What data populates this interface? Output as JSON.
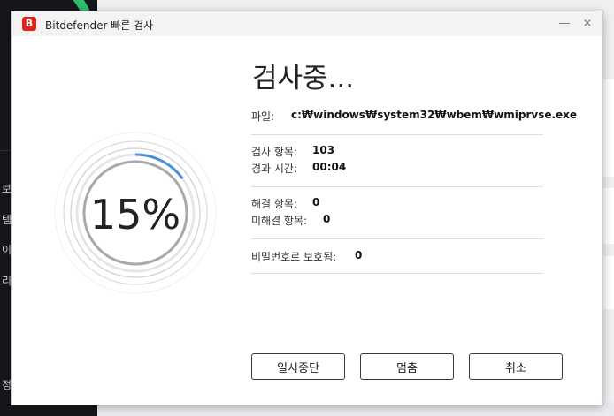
{
  "background_app": {
    "sidebar_items": [
      "보",
      "템",
      "이",
      "리",
      "정"
    ]
  },
  "window": {
    "title": "Bitdefender 빠른 검사",
    "logo_letter": "B",
    "minimize": "—",
    "close": "×"
  },
  "progress": {
    "percent_text": "15%",
    "fraction": 0.15
  },
  "scan": {
    "heading": "검사중...",
    "file_label": "파일:",
    "file_value": "c:₩windows₩system32₩wbem₩wmiprvse.exe",
    "scanned_label": "검사 항목:",
    "scanned_value": "103",
    "elapsed_label": "경과 시간:",
    "elapsed_value": "00:04",
    "resolved_label": "해결 항목:",
    "resolved_value": "0",
    "unresolved_label": "미해결 항목:",
    "unresolved_value": "0",
    "password_label": "비밀번호로 보호됨:",
    "password_value": "0"
  },
  "buttons": {
    "pause": "일시중단",
    "stop": "멈춤",
    "cancel": "취소"
  },
  "colors": {
    "brand_red": "#e2231a",
    "progress_blue": "#4a90d9",
    "accent_green": "#2dbd6e"
  }
}
